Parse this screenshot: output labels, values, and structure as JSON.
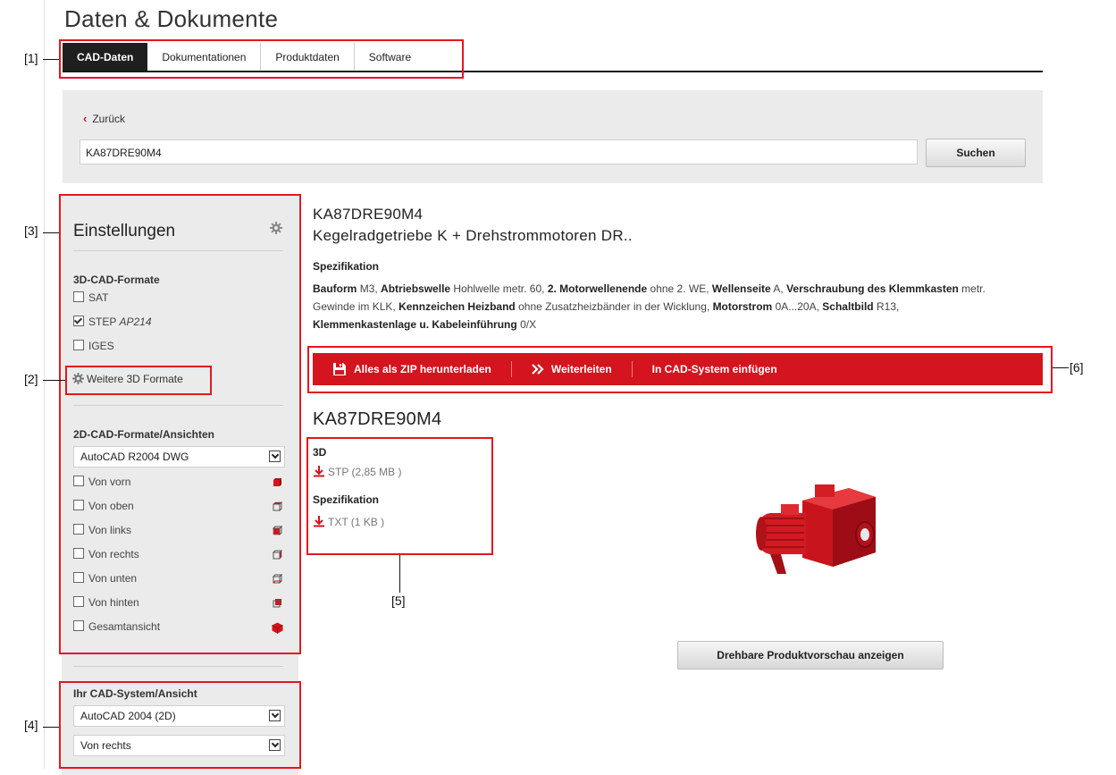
{
  "page": {
    "title": "Daten & Dokumente"
  },
  "tabs": [
    {
      "label": "CAD-Daten",
      "active": true
    },
    {
      "label": "Dokumentationen",
      "active": false
    },
    {
      "label": "Produktdaten",
      "active": false
    },
    {
      "label": "Software",
      "active": false
    }
  ],
  "search": {
    "back_label": "Zurück",
    "value": "KA87DRE90M4",
    "button_label": "Suchen"
  },
  "sidebar": {
    "title": "Einstellungen",
    "formats_3d": {
      "heading": "3D-CAD-Formate",
      "items": [
        {
          "label": "SAT",
          "suffix": "",
          "checked": false
        },
        {
          "label": "STEP ",
          "suffix": "AP214",
          "checked": true
        },
        {
          "label": "IGES",
          "suffix": "",
          "checked": false
        }
      ],
      "more_label": "Weitere 3D Formate"
    },
    "formats_2d": {
      "heading": "2D-CAD-Formate/Ansichten",
      "selected": "AutoCAD R2004 DWG",
      "views": [
        {
          "label": "Von vorn",
          "checked": false
        },
        {
          "label": "Von oben",
          "checked": false
        },
        {
          "label": "Von links",
          "checked": false
        },
        {
          "label": "Von rechts",
          "checked": false
        },
        {
          "label": "Von unten",
          "checked": false
        },
        {
          "label": "Von hinten",
          "checked": false
        },
        {
          "label": "Gesamtansicht",
          "checked": false
        }
      ]
    },
    "cad_system": {
      "heading": "Ihr CAD-System/Ansicht",
      "system_selected": "AutoCAD 2004 (2D)",
      "view_selected": "Von rechts"
    }
  },
  "product": {
    "code": "KA87DRE90M4",
    "name": "Kegelradgetriebe K + Drehstrommotoren DR..",
    "spec_title": "Spezifikation",
    "spec": [
      {
        "k": "Bauform",
        "v": "M3,"
      },
      {
        "k": "Abtriebswelle",
        "v": "Hohlwelle metr. 60,"
      },
      {
        "k": "2. Motorwellenende",
        "v": "ohne 2. WE,"
      },
      {
        "k": "Wellenseite",
        "v": "A,"
      },
      {
        "k": "Verschraubung des Klemmkasten",
        "v": "metr. Gewinde im KLK,"
      },
      {
        "k": "Kennzeichen Heizband",
        "v": "ohne Zusatzheizbänder in der Wicklung,"
      },
      {
        "k": "Motorstrom",
        "v": "0A...20A,"
      },
      {
        "k": "Schaltbild",
        "v": "R13,"
      },
      {
        "k": "Klemmenkastenlage u. Kabeleinführung",
        "v": "0/X"
      }
    ]
  },
  "actions": {
    "zip_label": "Alles als ZIP herunterladen",
    "forward_label": "Weiterleiten",
    "insert_label": "In CAD-System einfügen"
  },
  "downloads": {
    "title": "KA87DRE90M4",
    "group_3d": {
      "heading": "3D",
      "link": "STP (2,85 MB )"
    },
    "group_spec": {
      "heading": "Spezifikation",
      "link": "TXT (1 KB )"
    }
  },
  "preview_button": "Drehbare Produktvorschau anzeigen",
  "callouts": {
    "c1": "[1]",
    "c2": "[2]",
    "c3": "[3]",
    "c4": "[4]",
    "c5": "[5]",
    "c6": "[6]"
  },
  "colors": {
    "accent": "#d4141e",
    "callout": "#e3161f",
    "tab_active": "#1f1f1f"
  }
}
